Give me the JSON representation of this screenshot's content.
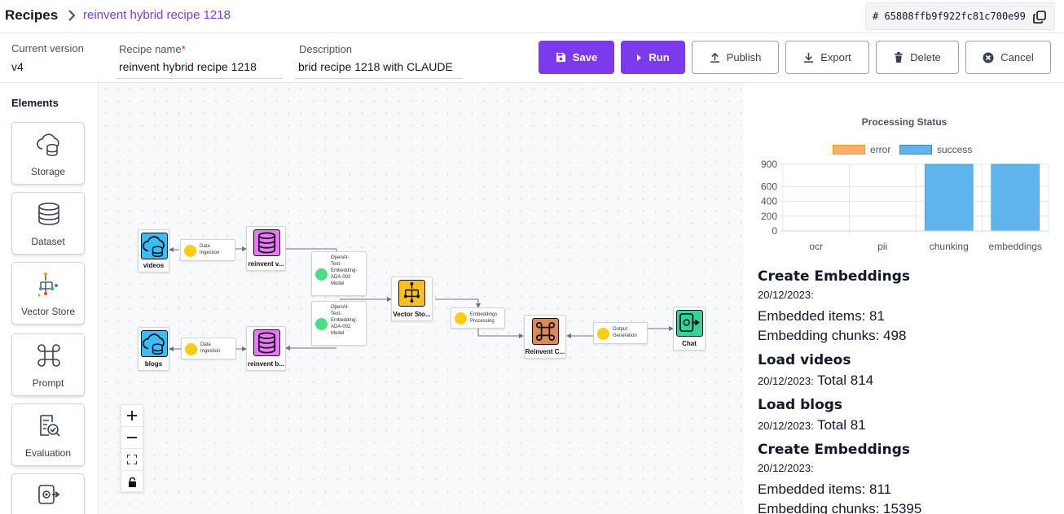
{
  "breadcrumb": {
    "root": "Recipes",
    "current": "reinvent hybrid recipe 1218"
  },
  "recipe_id": {
    "hash": "# 65808ffb9f922fc81c700e99"
  },
  "form": {
    "current_version_label": "Current version",
    "current_version_value": "v4",
    "recipe_name_label": "Recipe name",
    "recipe_name_required": "*",
    "recipe_name_value": "reinvent hybrid recipe 1218",
    "description_label": "Description",
    "description_value": "brid recipe 1218 with CLAUDE"
  },
  "toolbar": {
    "save": "Save",
    "run": "Run",
    "publish": "Publish",
    "export": "Export",
    "delete": "Delete",
    "cancel": "Cancel"
  },
  "sidebar": {
    "title": "Elements",
    "items": [
      {
        "label": "Storage",
        "icon": "cloud-storage-icon"
      },
      {
        "label": "Dataset",
        "icon": "database-icon"
      },
      {
        "label": "Vector Store",
        "icon": "vector-store-icon"
      },
      {
        "label": "Prompt",
        "icon": "command-icon"
      },
      {
        "label": "Evaluation",
        "icon": "evaluation-icon"
      },
      {
        "label": "",
        "icon": "chat-output-icon"
      }
    ]
  },
  "canvas": {
    "nodes": {
      "videos": "videos",
      "blogs": "blogs",
      "reinvent_v": "reinvent v...",
      "reinvent_b": "reinvent b...",
      "vector_store": "Vector Sto...",
      "reinvent_c": "Reinvent C...",
      "chat": "Chat"
    },
    "edges": {
      "ingest_top": [
        "Data",
        "Ingestion"
      ],
      "ingest_bottom": [
        "Data",
        "Ingestion"
      ],
      "model_top": [
        "OpenAI-",
        "Text-",
        "Embedding-",
        "ADA-002",
        "Model"
      ],
      "model_bottom": [
        "OpenAI-",
        "Text-",
        "Embedding-",
        "ADA-002",
        "Model"
      ],
      "emb_processing": [
        "Embeddings",
        "Processing"
      ],
      "output_generation": [
        "Output",
        "Generation"
      ]
    },
    "colors": {
      "storage": "#38bdf8",
      "dataset": "#e879f9",
      "vector": "#fbbf24",
      "prompt": "#d9895b",
      "chat": "#34d399",
      "edge_icon_yellow": "#facc15",
      "edge_icon_green": "#4ade80"
    }
  },
  "status_panel": {
    "chart_data": {
      "type": "bar",
      "title": "Processing Status",
      "categories": [
        "ocr",
        "pii",
        "chunking",
        "embeddings"
      ],
      "series": [
        {
          "name": "error",
          "values": [
            0,
            0,
            0,
            0
          ],
          "color": "#fdae6b"
        },
        {
          "name": "success",
          "values": [
            0,
            0,
            900,
            900
          ],
          "color": "#5fb4ec"
        }
      ],
      "yticks": [
        0,
        200,
        400,
        600,
        900
      ],
      "ylim": [
        0,
        900
      ],
      "legend": "top-center"
    },
    "sections": [
      {
        "title": "Create Embeddings",
        "lines": [
          {
            "date": "20/12/2023:",
            "text": ""
          },
          {
            "date": "",
            "text": "Embedded items: 81"
          },
          {
            "date": "",
            "text": "Embedding chunks: 498"
          }
        ]
      },
      {
        "title": "Load videos",
        "lines": [
          {
            "date": "20/12/2023:",
            "text": "Total 814"
          }
        ]
      },
      {
        "title": "Load blogs",
        "lines": [
          {
            "date": "20/12/2023:",
            "text": "Total 81"
          }
        ]
      },
      {
        "title": "Create Embeddings",
        "lines": [
          {
            "date": "20/12/2023:",
            "text": ""
          },
          {
            "date": "",
            "text": "Embedded items: 811"
          },
          {
            "date": "",
            "text": "Embedding chunks: 15395"
          }
        ]
      }
    ]
  }
}
